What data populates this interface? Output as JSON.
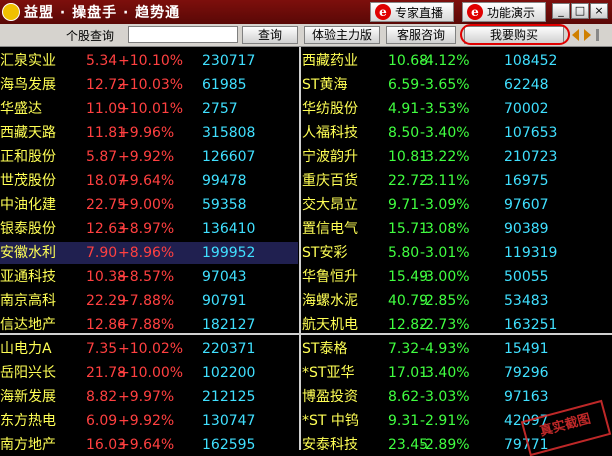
{
  "header": {
    "brand": "益盟 · 操盘手 · 趋势通",
    "expert_btn": "专家直播",
    "demo_btn": "功能演示",
    "win_min": "_",
    "win_max": "□",
    "win_close": "×"
  },
  "toolbar": {
    "search_label": "个股查询",
    "search_value": "",
    "query_btn": "查询",
    "trial_btn": "体验主力版",
    "service_btn": "客服咨询",
    "buy_btn": "我要购买"
  },
  "gainers": [
    {
      "name": "汇泉实业",
      "price": "5.34",
      "pct": "+10.10%",
      "vol": "230717"
    },
    {
      "name": "海鸟发展",
      "price": "12.72",
      "pct": "+10.03%",
      "vol": "61985"
    },
    {
      "name": "华盛达",
      "price": "11.09",
      "pct": "+10.01%",
      "vol": "2757"
    },
    {
      "name": "西藏天路",
      "price": "11.81",
      "pct": "+9.96%",
      "vol": "315808"
    },
    {
      "name": "正和股份",
      "price": "5.87",
      "pct": "+9.92%",
      "vol": "126607"
    },
    {
      "name": "世茂股份",
      "price": "18.07",
      "pct": "+9.64%",
      "vol": "99478"
    },
    {
      "name": "中油化建",
      "price": "22.75",
      "pct": "+9.00%",
      "vol": "59358"
    },
    {
      "name": "银泰股份",
      "price": "12.63",
      "pct": "+8.97%",
      "vol": "136410"
    },
    {
      "name": "安徽水利",
      "price": "7.90",
      "pct": "+8.96%",
      "vol": "199952"
    },
    {
      "name": "亚通科技",
      "price": "10.38",
      "pct": "+8.57%",
      "vol": "97043"
    },
    {
      "name": "南京高科",
      "price": "22.29",
      "pct": "+7.88%",
      "vol": "90791"
    },
    {
      "name": "信达地产",
      "price": "12.86",
      "pct": "+7.88%",
      "vol": "182127"
    }
  ],
  "losers": [
    {
      "name": "西藏药业",
      "price": "10.68",
      "pct": "-4.12%",
      "vol": "108452"
    },
    {
      "name": "ST黄海",
      "price": "6.59",
      "pct": "-3.65%",
      "vol": "62248"
    },
    {
      "name": "华纺股份",
      "price": "4.91",
      "pct": "-3.53%",
      "vol": "70002"
    },
    {
      "name": "人福科技",
      "price": "8.50",
      "pct": "-3.40%",
      "vol": "107653"
    },
    {
      "name": "宁波韵升",
      "price": "10.81",
      "pct": "-3.22%",
      "vol": "210723"
    },
    {
      "name": "重庆百货",
      "price": "22.72",
      "pct": "-3.11%",
      "vol": "16975"
    },
    {
      "name": "交大昂立",
      "price": "9.71",
      "pct": "-3.09%",
      "vol": "97607"
    },
    {
      "name": "置信电气",
      "price": "15.71",
      "pct": "-3.08%",
      "vol": "90389"
    },
    {
      "name": "ST安彩",
      "price": "5.80",
      "pct": "-3.01%",
      "vol": "119319"
    },
    {
      "name": "华鲁恒升",
      "price": "15.49",
      "pct": "-3.00%",
      "vol": "50055"
    },
    {
      "name": "海螺水泥",
      "price": "40.79",
      "pct": "-2.85%",
      "vol": "53483"
    },
    {
      "name": "航天机电",
      "price": "12.82",
      "pct": "-2.73%",
      "vol": "163251"
    }
  ],
  "gainers2": [
    {
      "name": "山电力A",
      "price": "7.35",
      "pct": "+10.02%",
      "vol": "220371"
    },
    {
      "name": "岳阳兴长",
      "price": "21.78",
      "pct": "+10.00%",
      "vol": "102200"
    },
    {
      "name": "海新发展",
      "price": "8.82",
      "pct": "+9.97%",
      "vol": "212125"
    },
    {
      "name": "东方热电",
      "price": "6.09",
      "pct": "+9.92%",
      "vol": "130747"
    },
    {
      "name": "南方地产",
      "price": "16.03",
      "pct": "+9.64%",
      "vol": "162595"
    }
  ],
  "losers2": [
    {
      "name": "ST泰格",
      "price": "7.32",
      "pct": "-4.93%",
      "vol": "15491"
    },
    {
      "name": "*ST亚华",
      "price": "17.01",
      "pct": "-3.40%",
      "vol": "79296"
    },
    {
      "name": "博盈投资",
      "price": "8.62",
      "pct": "-3.03%",
      "vol": "97163"
    },
    {
      "name": "*ST 中钨",
      "price": "9.31",
      "pct": "-2.91%",
      "vol": "42097"
    },
    {
      "name": "安泰科技",
      "price": "23.45",
      "pct": "-2.89%",
      "vol": "79771"
    }
  ],
  "stamp": "真实截图"
}
